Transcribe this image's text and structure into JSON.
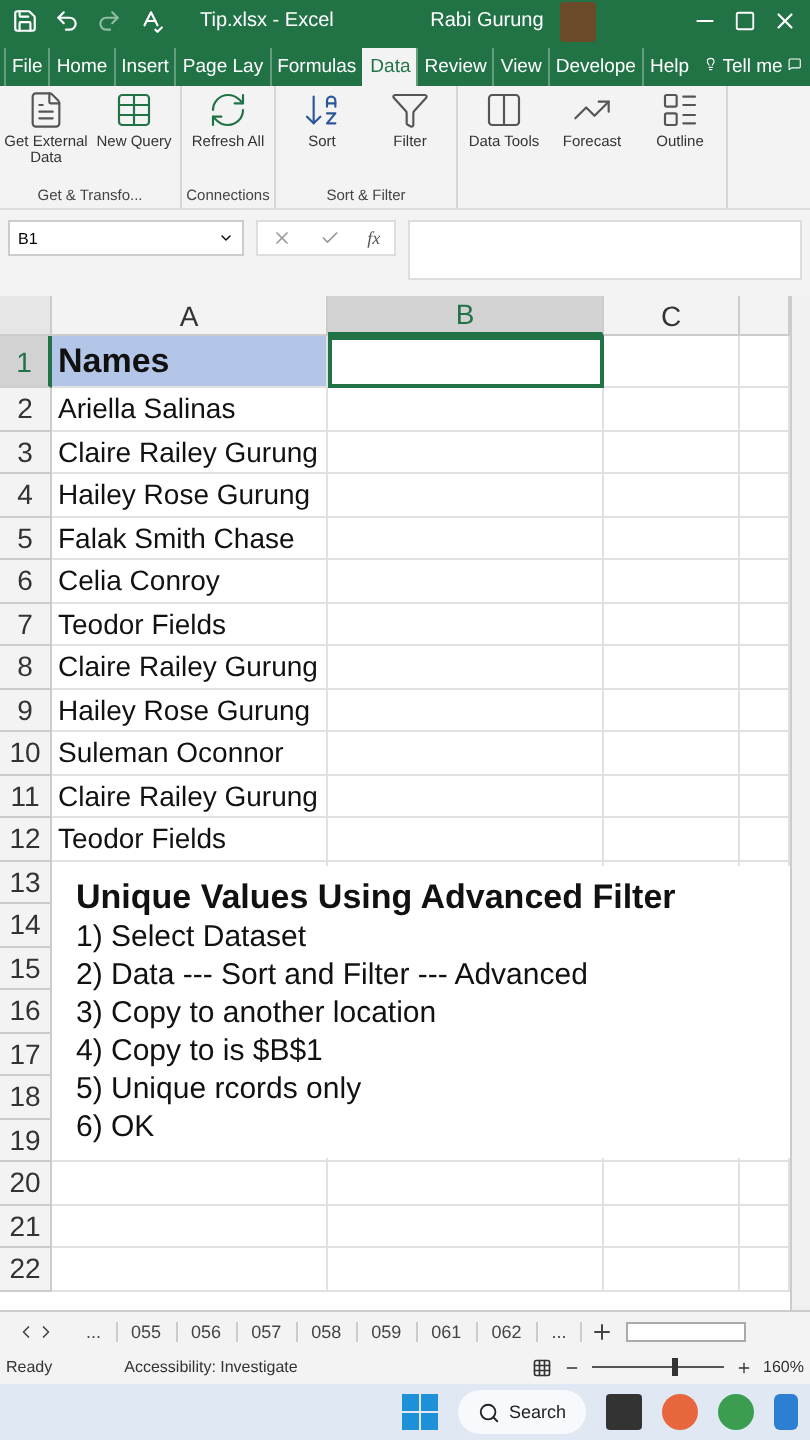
{
  "title_bar": {
    "filename": "Tip.xlsx - Excel",
    "user": "Rabi Gurung"
  },
  "menu_tabs": [
    {
      "label": "File",
      "selected": false
    },
    {
      "label": "Home",
      "selected": false
    },
    {
      "label": "Insert",
      "selected": false
    },
    {
      "label": "Page Lay",
      "selected": false
    },
    {
      "label": "Formulas",
      "selected": false
    },
    {
      "label": "Data",
      "selected": true
    },
    {
      "label": "Review",
      "selected": false
    },
    {
      "label": "View",
      "selected": false
    },
    {
      "label": "Develope",
      "selected": false
    },
    {
      "label": "Help",
      "selected": false
    }
  ],
  "tell_me": "Tell me",
  "ribbon": [
    {
      "label": "Get & Transfo...",
      "buttons": [
        {
          "kind": "doc",
          "label": "Get External Data"
        },
        {
          "kind": "query",
          "label": "New Query"
        }
      ]
    },
    {
      "label": "Connections",
      "buttons": [
        {
          "kind": "refresh",
          "label": "Refresh All"
        }
      ]
    },
    {
      "label": "Sort & Filter",
      "buttons": [
        {
          "kind": "sort",
          "label": "Sort"
        },
        {
          "kind": "filter",
          "label": "Filter"
        }
      ]
    },
    {
      "buttons": [
        {
          "kind": "tools",
          "label": "Data Tools"
        },
        {
          "kind": "forecast",
          "label": "Forecast"
        },
        {
          "kind": "outline",
          "label": "Outline"
        }
      ]
    }
  ],
  "name_box": "B1",
  "fx": "fx",
  "columns": [
    {
      "label": "A",
      "selected": false
    },
    {
      "label": "B",
      "selected": true
    },
    {
      "label": "C",
      "selected": false
    }
  ],
  "rows": [
    {
      "number": "1",
      "selected": true,
      "name": "Names",
      "header": true
    },
    {
      "number": "2",
      "selected": false,
      "name": "Ariella Salinas"
    },
    {
      "number": "3",
      "selected": false,
      "name": "Claire Railey Gurung"
    },
    {
      "number": "4",
      "selected": false,
      "name": "Hailey Rose Gurung"
    },
    {
      "number": "5",
      "selected": false,
      "name": "Falak Smith Chase"
    },
    {
      "number": "6",
      "selected": false,
      "name": "Celia Conroy"
    },
    {
      "number": "7",
      "selected": false,
      "name": "Teodor Fields"
    },
    {
      "number": "8",
      "selected": false,
      "name": "Claire Railey Gurung"
    },
    {
      "number": "9",
      "selected": false,
      "name": "Hailey Rose Gurung"
    },
    {
      "number": "10",
      "selected": false,
      "name": "Suleman Oconnor"
    },
    {
      "number": "11",
      "selected": false,
      "name": "Claire Railey Gurung"
    },
    {
      "number": "12",
      "selected": false,
      "name": "Teodor Fields"
    },
    {
      "number": "13",
      "selected": false
    },
    {
      "number": "14",
      "selected": false
    },
    {
      "number": "15",
      "selected": false
    },
    {
      "number": "16",
      "selected": false
    },
    {
      "number": "17",
      "selected": false
    },
    {
      "number": "18",
      "selected": false
    },
    {
      "number": "19",
      "selected": false
    },
    {
      "number": "20",
      "selected": false
    },
    {
      "number": "21",
      "selected": false
    },
    {
      "number": "22",
      "selected": false
    }
  ],
  "overlay": {
    "title": "Unique Values Using Advanced Filter",
    "steps": [
      "1) Select Dataset",
      "2) Data --- Sort and Filter --- Advanced",
      "3) Copy to another location",
      "4) Copy to is $B$1",
      "5) Unique rcords only",
      "6) OK"
    ]
  },
  "sheet_tabs": [
    "...",
    "055",
    "056",
    "057",
    "058",
    "059",
    "061",
    "062",
    "..."
  ],
  "status": {
    "ready": "Ready",
    "accessibility": "Accessibility: Investigate",
    "zoom": "160%",
    "level": 0.62
  },
  "taskbar": {
    "search": "Search"
  }
}
